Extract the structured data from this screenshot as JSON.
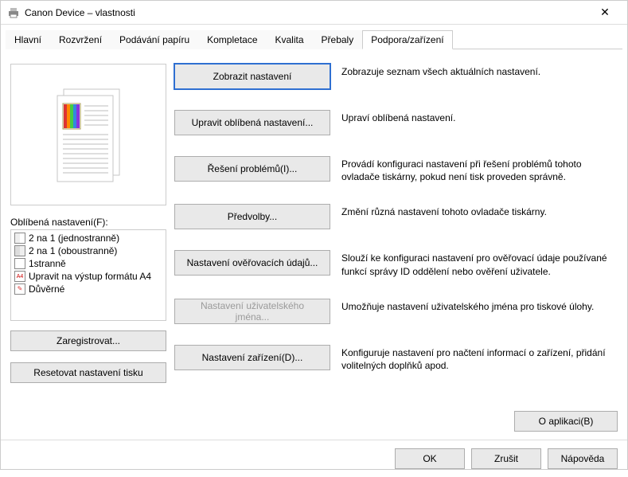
{
  "window": {
    "title": "Canon Device – vlastnosti"
  },
  "tabs": {
    "t0": "Hlavní",
    "t1": "Rozvržení",
    "t2": "Podávání papíru",
    "t3": "Kompletace",
    "t4": "Kvalita",
    "t5": "Přebaly",
    "t6": "Podpora/zařízení"
  },
  "left": {
    "favorites_label": "Oblíbená nastavení(F):",
    "items": {
      "i0": "2 na 1 (jednostranně)",
      "i1": "2 na 1 (oboustranně)",
      "i2": "1stranně",
      "i3": "Upravit na výstup formátu A4",
      "i4": "Důvěrné"
    },
    "register_btn": "Zaregistrovat...",
    "reset_btn": "Resetovat nastavení tisku"
  },
  "right": {
    "b0": "Zobrazit nastavení",
    "d0": "Zobrazuje seznam všech aktuálních nastavení.",
    "b1": "Upravit oblíbená nastavení...",
    "d1": "Upraví oblíbená nastavení.",
    "b2": "Řešení problémů(I)...",
    "d2": "Provádí konfiguraci nastavení při řešení problémů tohoto ovladače tiskárny, pokud není tisk proveden správně.",
    "b3": "Předvolby...",
    "d3": "Změní různá nastavení tohoto ovladače tiskárny.",
    "b4": "Nastavení ověřovacích údajů...",
    "d4": "Slouží ke konfiguraci nastavení pro ověřovací údaje používané funkcí správy ID oddělení nebo ověření uživatele.",
    "b5": "Nastavení uživatelského jména...",
    "d5": "Umožňuje nastavení uživatelského jména pro tiskové úlohy.",
    "b6": "Nastavení zařízení(D)...",
    "d6": "Konfiguruje nastavení pro načtení informací o zařízení, přidání volitelných doplňků apod.",
    "about_btn": "O aplikaci(B)"
  },
  "footer": {
    "ok": "OK",
    "cancel": "Zrušit",
    "help": "Nápověda"
  }
}
